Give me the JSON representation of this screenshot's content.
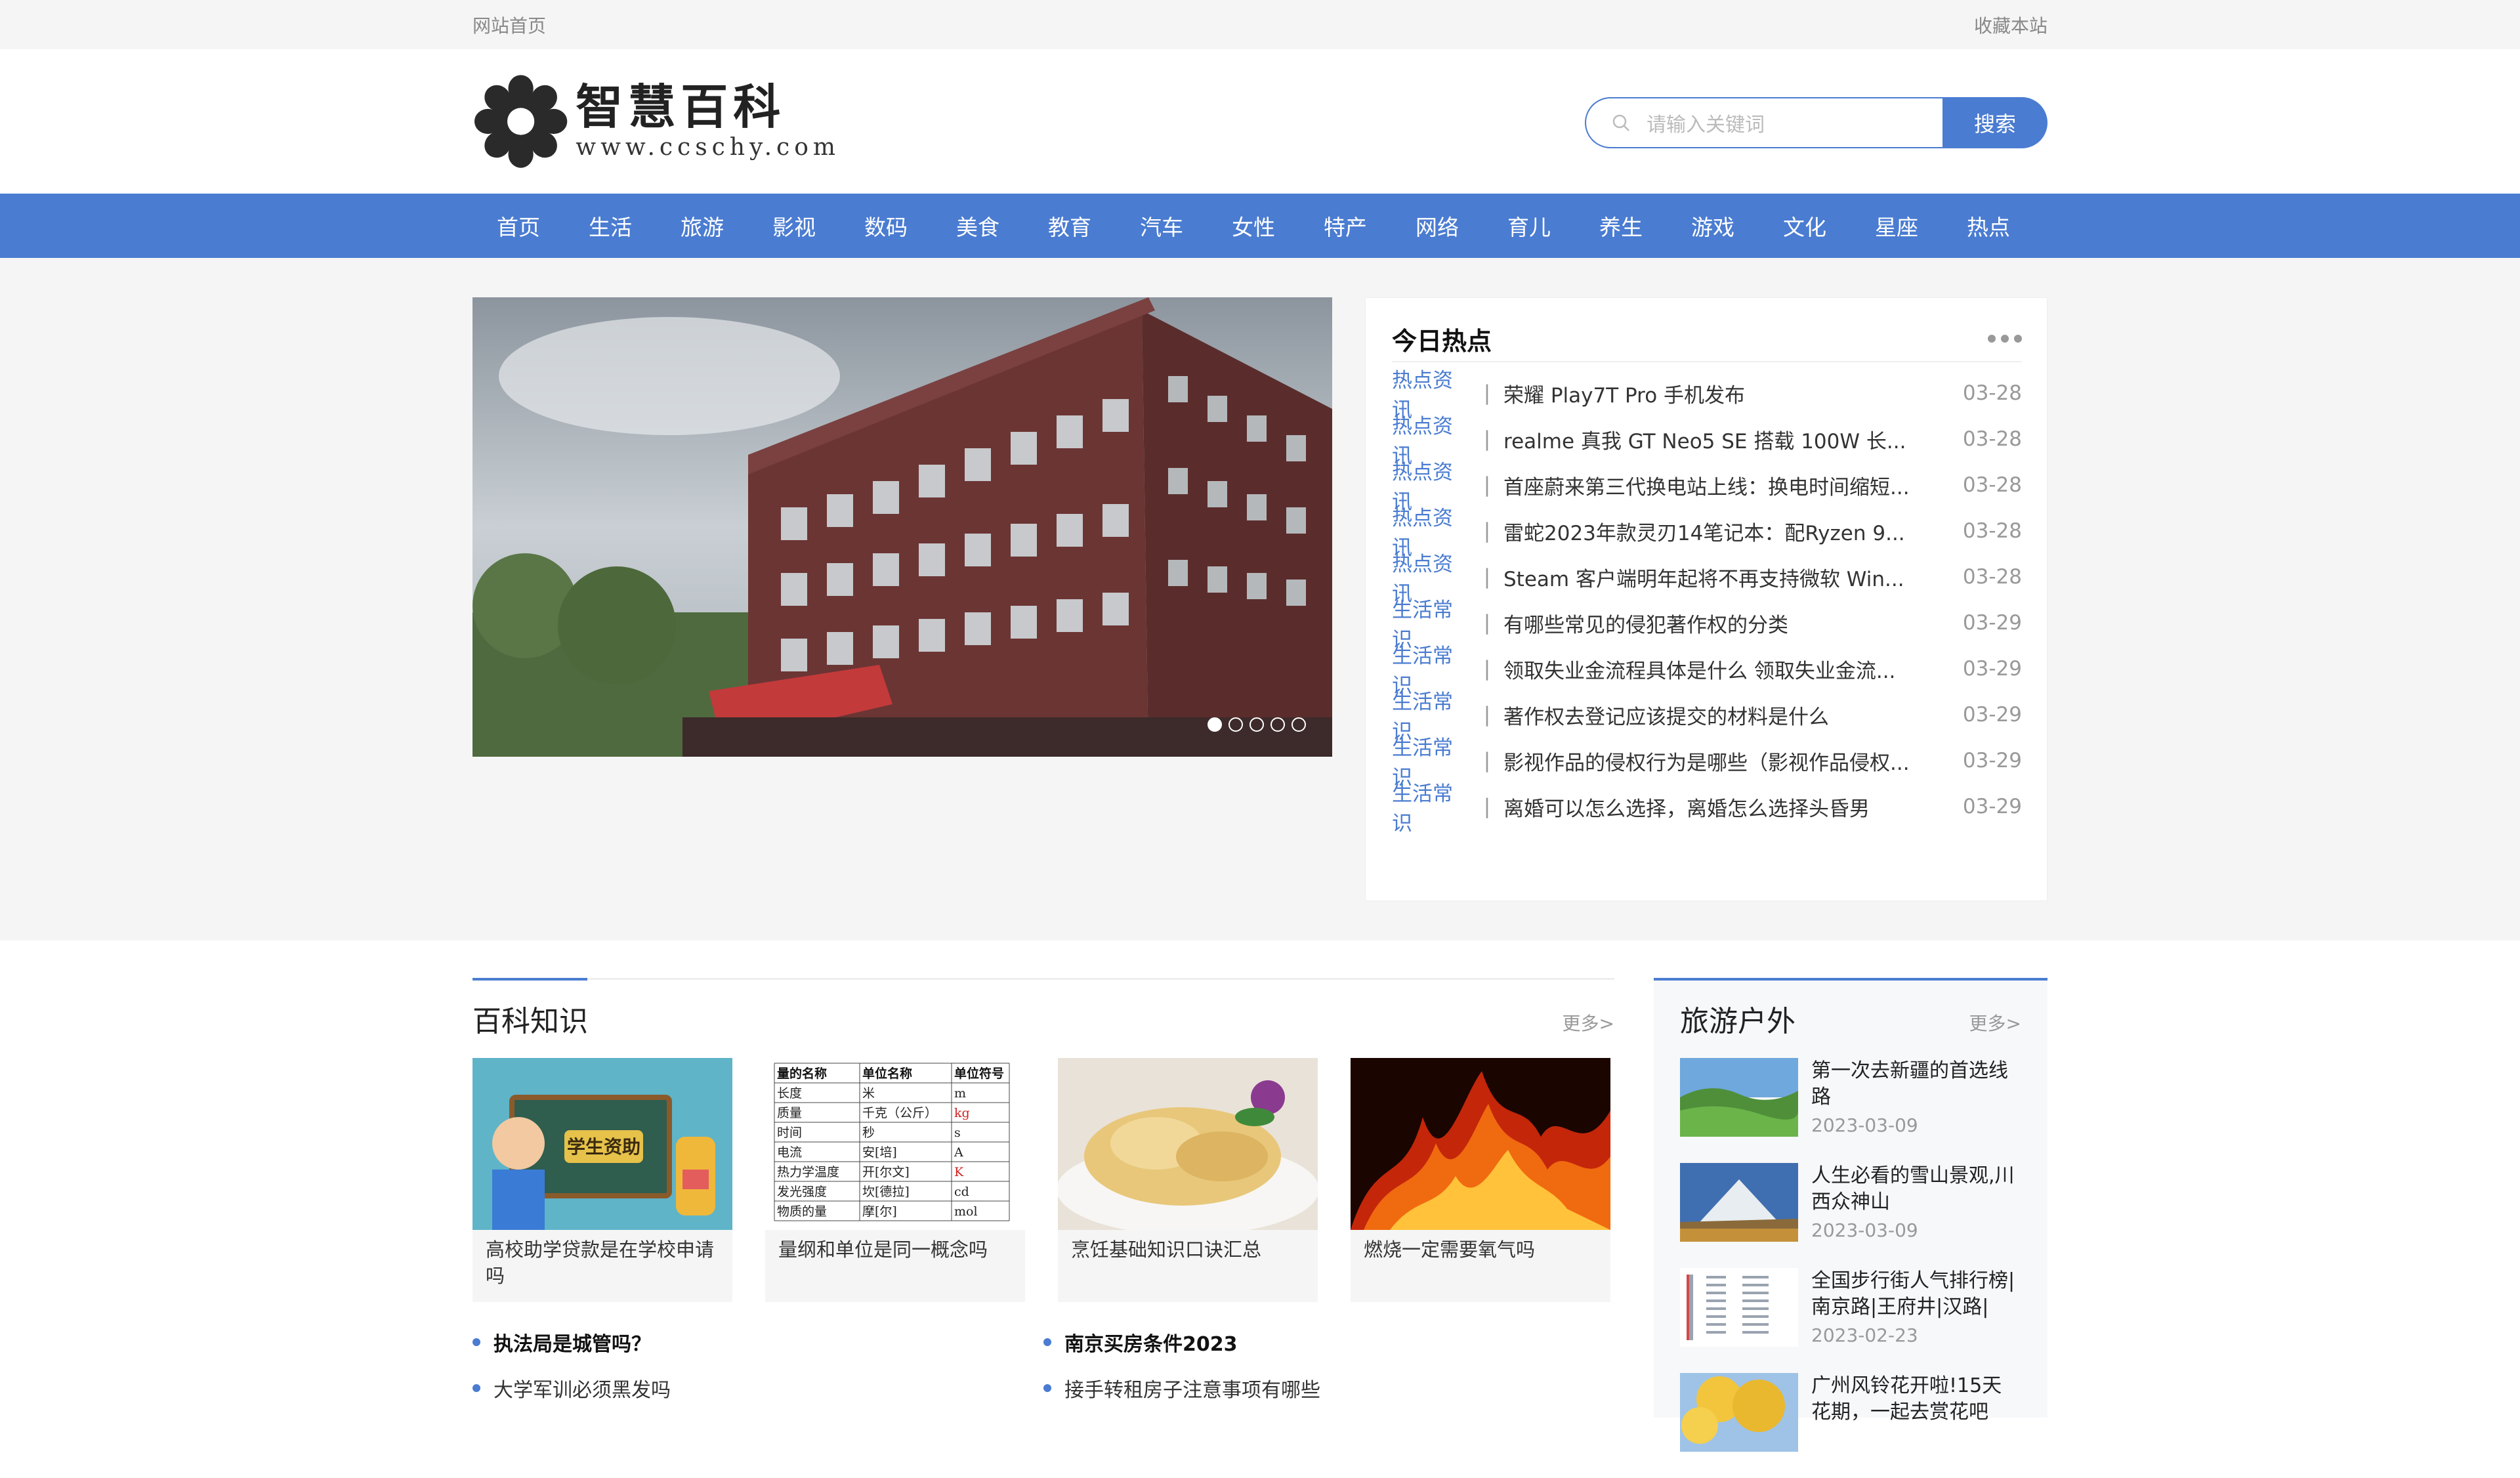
{
  "topbar": {
    "home": "网站首页",
    "bookmark": "收藏本站"
  },
  "logo": {
    "cn": "智慧百科",
    "en": "www.ccschy.com"
  },
  "search": {
    "placeholder": "请输入关键词",
    "button": "搜索"
  },
  "nav": [
    "首页",
    "生活",
    "旅游",
    "影视",
    "数码",
    "美食",
    "教育",
    "汽车",
    "女性",
    "特产",
    "网络",
    "育儿",
    "养生",
    "游戏",
    "文化",
    "星座",
    "热点"
  ],
  "slider": {
    "dots": 5,
    "active": 0
  },
  "hot": {
    "title": "今日热点",
    "items": [
      {
        "cat": "热点资讯",
        "title": "荣耀 Play7T Pro 手机发布",
        "date": "03-28"
      },
      {
        "cat": "热点资讯",
        "title": "realme 真我 GT Neo5 SE 搭载 100W 长...",
        "date": "03-28"
      },
      {
        "cat": "热点资讯",
        "title": "首座蔚来第三代换电站上线：换电时间缩短...",
        "date": "03-28"
      },
      {
        "cat": "热点资讯",
        "title": "雷蛇2023年款灵刃14笔记本：配Ryzen 9...",
        "date": "03-28"
      },
      {
        "cat": "热点资讯",
        "title": "Steam 客户端明年起将不再支持微软 Win...",
        "date": "03-28"
      },
      {
        "cat": "生活常识",
        "title": "有哪些常见的侵犯著作权的分类",
        "date": "03-29"
      },
      {
        "cat": "生活常识",
        "title": "领取失业金流程具体是什么 领取失业金流...",
        "date": "03-29"
      },
      {
        "cat": "生活常识",
        "title": "著作权去登记应该提交的材料是什么",
        "date": "03-29"
      },
      {
        "cat": "生活常识",
        "title": "影视作品的侵权行为是哪些（影视作品侵权...",
        "date": "03-29"
      },
      {
        "cat": "生活常识",
        "title": "离婚可以怎么选择，离婚怎么选择头昏男",
        "date": "03-29"
      }
    ]
  },
  "knowledge": {
    "title": "百科知识",
    "more": "更多>",
    "cards": [
      {
        "caption": "高校助学贷款是在学校申请吗",
        "img_text": "学生资助"
      },
      {
        "caption": "量纲和单位是同一概念吗"
      },
      {
        "caption": "烹饪基础知识口诀汇总"
      },
      {
        "caption": "燃烧一定需要氧气吗"
      }
    ],
    "units_table": {
      "headers": [
        "量的名称",
        "单位名称",
        "单位符号"
      ],
      "rows": [
        [
          "长度",
          "米",
          "m"
        ],
        [
          "质量",
          "千克（公斤）",
          "kg"
        ],
        [
          "时间",
          "秒",
          "s"
        ],
        [
          "电流",
          "安[培]",
          "A"
        ],
        [
          "热力学温度",
          "开[尔文]",
          "K"
        ],
        [
          "发光强度",
          "坎[德拉]",
          "cd"
        ],
        [
          "物质的量",
          "摩[尔]",
          "mol"
        ]
      ]
    },
    "list_left": [
      {
        "text": "执法局是城管吗？",
        "strong": true
      },
      {
        "text": "大学军训必须黑发吗",
        "strong": false
      }
    ],
    "list_right": [
      {
        "text": "南京买房条件2023",
        "strong": true
      },
      {
        "text": "接手转租房子注意事项有哪些",
        "strong": false
      }
    ]
  },
  "travel": {
    "title": "旅游户外",
    "more": "更多>",
    "items": [
      {
        "title": "第一次去新疆的首选线路",
        "date": "2023-03-09"
      },
      {
        "title": "人生必看的雪山景观,川西众神山",
        "date": "2023-03-09"
      },
      {
        "title": "全国步行街人气排行榜|南京路|王府井|汉路|",
        "date": "2023-02-23"
      },
      {
        "title": "广州风铃花开啦!15天花期，一起去赏花吧",
        "date": ""
      }
    ]
  },
  "colors": {
    "accent": "#4a7cd1",
    "band": "#f5f5f5"
  }
}
